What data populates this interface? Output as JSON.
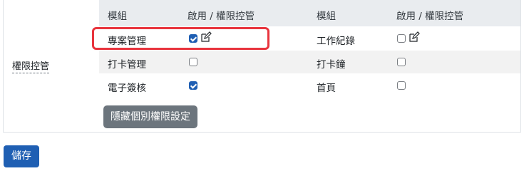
{
  "section_label": "權限控管",
  "table": {
    "headers": [
      "模組",
      "啟用 / 權限控管",
      "模組",
      "啟用 / 權限控管"
    ],
    "rows": [
      {
        "left": {
          "name": "專案管理",
          "enabled": true,
          "editable": true
        },
        "right": {
          "name": "工作紀錄",
          "enabled": false,
          "editable": true
        }
      },
      {
        "left": {
          "name": "打卡管理",
          "enabled": false,
          "editable": false
        },
        "right": {
          "name": "打卡鐘",
          "enabled": false,
          "editable": false
        }
      },
      {
        "left": {
          "name": "電子簽核",
          "enabled": true,
          "editable": false
        },
        "right": {
          "name": "首頁",
          "enabled": false,
          "editable": false
        }
      }
    ]
  },
  "buttons": {
    "hide_label": "隱藏個別權限設定",
    "save_label": "儲存"
  },
  "colors": {
    "primary": "#1f5fb3",
    "secondary": "#6c757d",
    "highlight": "#e8343d",
    "header_bg": "#e9ecef"
  }
}
